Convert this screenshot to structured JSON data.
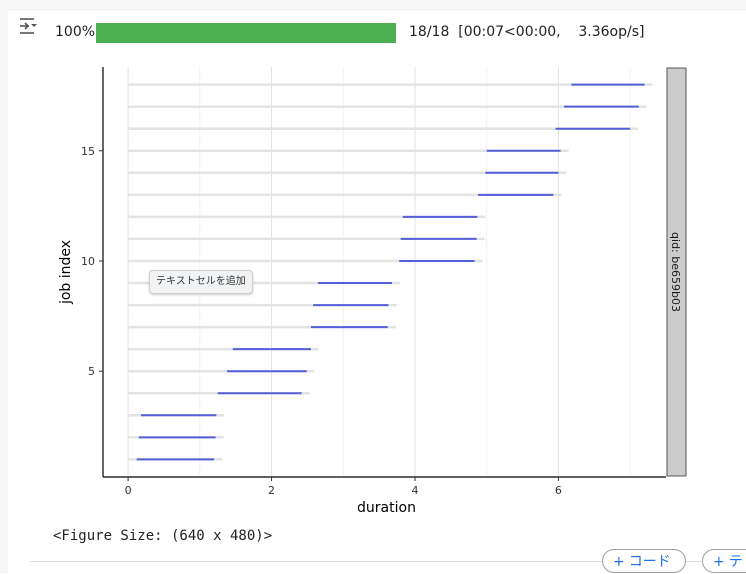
{
  "cell": {
    "toggle_icon": "output-collapse-icon",
    "progress": {
      "percent_label": "100%",
      "fraction": 1.0,
      "stats": "18/18  [00:07<00:00,    3.36op/s]",
      "bar_color": "#4caf50"
    },
    "figure_size_text": "<Figure Size: (640 x 480)>",
    "tooltip": "テキストセルを追加",
    "buttons": {
      "add_code": "コード",
      "add_text": "テ"
    }
  },
  "chart_data": {
    "type": "range-bar",
    "title": "",
    "xlabel": "duration",
    "ylabel": "job index",
    "xlim": [
      -0.35,
      7.5
    ],
    "ylim": [
      0.2,
      18.8
    ],
    "x_ticks": [
      0,
      2,
      4,
      6
    ],
    "y_ticks": [
      5,
      10,
      15
    ],
    "facet_label": "qid: be659b03",
    "grid": true,
    "series": [
      {
        "name": "",
        "color": "#5560d8",
        "jobs": [
          {
            "job": 1,
            "start": 0.12,
            "end": 1.2
          },
          {
            "job": 2,
            "start": 0.15,
            "end": 1.22
          },
          {
            "job": 3,
            "start": 0.18,
            "end": 1.23
          },
          {
            "job": 4,
            "start": 1.25,
            "end": 2.42
          },
          {
            "job": 5,
            "start": 1.38,
            "end": 2.49
          },
          {
            "job": 6,
            "start": 1.46,
            "end": 2.55
          },
          {
            "job": 7,
            "start": 2.55,
            "end": 3.62
          },
          {
            "job": 8,
            "start": 2.58,
            "end": 3.63
          },
          {
            "job": 9,
            "start": 2.65,
            "end": 3.68
          },
          {
            "job": 10,
            "start": 3.78,
            "end": 4.83
          },
          {
            "job": 11,
            "start": 3.8,
            "end": 4.86
          },
          {
            "job": 12,
            "start": 3.83,
            "end": 4.87
          },
          {
            "job": 13,
            "start": 4.88,
            "end": 5.93
          },
          {
            "job": 14,
            "start": 4.98,
            "end": 6.0
          },
          {
            "job": 15,
            "start": 5.0,
            "end": 6.03
          },
          {
            "job": 16,
            "start": 5.96,
            "end": 7.0
          },
          {
            "job": 17,
            "start": 6.08,
            "end": 7.12
          },
          {
            "job": 18,
            "start": 6.18,
            "end": 7.2
          }
        ]
      }
    ]
  }
}
